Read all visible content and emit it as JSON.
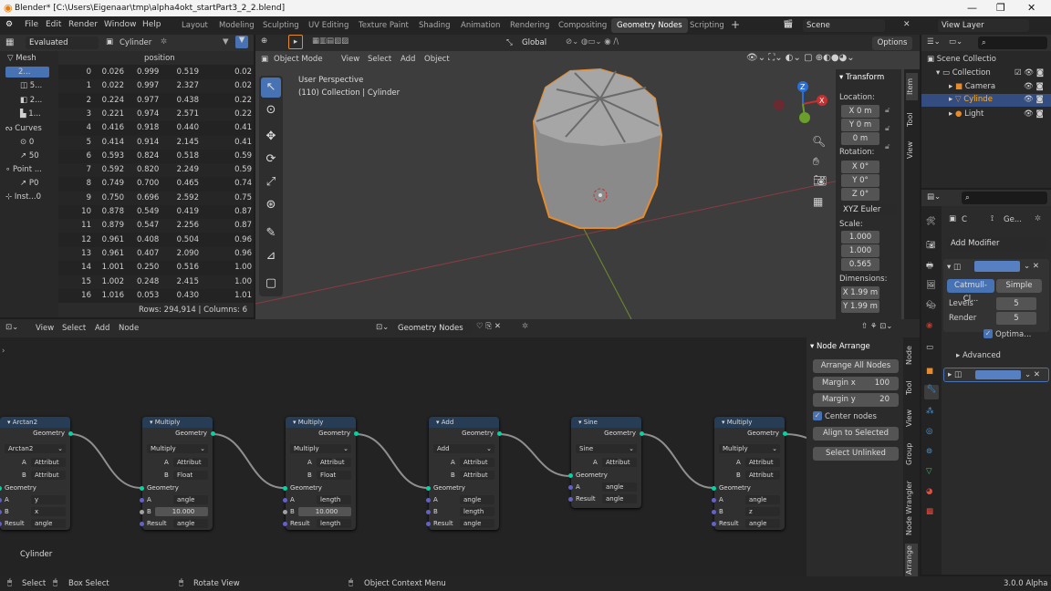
{
  "window": {
    "title": "Blender* [C:\\Users\\Eigenaar\\tmp\\alpha4okt_startPart3_2_2.blend]",
    "min": "—",
    "max": "❐",
    "close": "✕"
  },
  "menu": [
    "File",
    "Edit",
    "Render",
    "Window",
    "Help"
  ],
  "workspaces": [
    "Layout",
    "Modeling",
    "Sculpting",
    "UV Editing",
    "Texture Paint",
    "Shading",
    "Animation",
    "Rendering",
    "Compositing",
    "Geometry Nodes",
    "Scripting"
  ],
  "active_workspace": "Geometry Nodes",
  "scene": "Scene",
  "view_layer": "View Layer",
  "spreadsheet": {
    "mode": "Evaluated",
    "object": "Cylinder",
    "col_header": "position",
    "sidebar": [
      {
        "label": "Mesh"
      },
      {
        "label": "2..."
      },
      {
        "label": "5..."
      },
      {
        "label": "2..."
      },
      {
        "label": "1..."
      },
      {
        "label": "Curves"
      },
      {
        "label": "0"
      },
      {
        "label": "50"
      },
      {
        "label": "Point ..."
      },
      {
        "label": "P0"
      },
      {
        "label": "Inst...0"
      }
    ],
    "rows": [
      [
        "0",
        "0.026",
        "0.999",
        "0.519",
        "0.02"
      ],
      [
        "1",
        "0.022",
        "0.997",
        "2.327",
        "0.02"
      ],
      [
        "2",
        "0.224",
        "0.977",
        "0.438",
        "0.22"
      ],
      [
        "3",
        "0.221",
        "0.974",
        "2.571",
        "0.22"
      ],
      [
        "4",
        "0.416",
        "0.918",
        "0.440",
        "0.41"
      ],
      [
        "5",
        "0.414",
        "0.914",
        "2.145",
        "0.41"
      ],
      [
        "6",
        "0.593",
        "0.824",
        "0.518",
        "0.59"
      ],
      [
        "7",
        "0.592",
        "0.820",
        "2.249",
        "0.59"
      ],
      [
        "8",
        "0.749",
        "0.700",
        "0.465",
        "0.74"
      ],
      [
        "9",
        "0.750",
        "0.696",
        "2.592",
        "0.75"
      ],
      [
        "10",
        "0.878",
        "0.549",
        "0.419",
        "0.87"
      ],
      [
        "11",
        "0.879",
        "0.547",
        "2.256",
        "0.87"
      ],
      [
        "12",
        "0.961",
        "0.408",
        "0.504",
        "0.96"
      ],
      [
        "13",
        "0.961",
        "0.407",
        "2.090",
        "0.96"
      ],
      [
        "14",
        "1.001",
        "0.250",
        "0.516",
        "1.00"
      ],
      [
        "15",
        "1.002",
        "0.248",
        "2.415",
        "1.00"
      ],
      [
        "16",
        "1.016",
        "0.053",
        "0.430",
        "1.01"
      ]
    ],
    "footer": "Rows: 294,914   |   Columns: 6"
  },
  "viewport": {
    "mode": "Object Mode",
    "menus": [
      "View",
      "Select",
      "Add",
      "Object"
    ],
    "transform": "Global",
    "options": "Options",
    "persp": "User Perspective",
    "collection": "(110) Collection | Cylinder"
  },
  "npanel": {
    "title": "Transform",
    "location": "Location:",
    "loc": [
      "X 0 m",
      "Y 0 m",
      "0 m"
    ],
    "rotation": "Rotation:",
    "rot": [
      "X 0°",
      "Y 0°",
      "Z 0°"
    ],
    "euler": "XYZ Euler",
    "scale": "Scale:",
    "scl": [
      "1.000",
      "1.000",
      "0.565"
    ],
    "dimensions": "Dimensions:",
    "dim": [
      "X 1.99 m",
      "Y 1.99 m"
    ],
    "tabs": [
      "Item",
      "Tool",
      "View"
    ]
  },
  "outliner": {
    "items": [
      "Scene Collectio",
      "Collection",
      "Camera",
      "Cylinde",
      "Light"
    ]
  },
  "properties": {
    "obj": "C",
    "mod": "Ge...",
    "add_modifier": "Add Modifier",
    "catmull": "Catmull-Cl...",
    "simple": "Simple",
    "levels_label": "Levels",
    "levels": "5",
    "render_label": "Render",
    "render": "5",
    "optimal": "Optima...",
    "advanced": "Advanced"
  },
  "node_editor": {
    "menus": [
      "View",
      "Select",
      "Add",
      "Node"
    ],
    "tree": "Geometry Nodes",
    "cylinder": "Cylinder",
    "arrange": {
      "title": "Node Arrange",
      "all": "Arrange All Nodes",
      "mx_label": "Margin x",
      "mx": "100",
      "my_label": "Margin y",
      "my": "20",
      "center": "Center nodes",
      "sel": "Align to Selected",
      "unlink": "Select Unlinked"
    },
    "tabs": [
      "Node",
      "Tool",
      "View",
      "Group",
      "Node Wrangler",
      "Arrange"
    ],
    "nodes": [
      {
        "title": "Arctan2",
        "op": "Arctan2",
        "a": "A",
        "a_val": "Attribut",
        "b": "B",
        "b_val": "Attribut",
        "geo_out": "Geometry",
        "geo_in": "Geometry",
        "in1": "A",
        "v1": "y",
        "in2": "B",
        "v2": "x",
        "res": "Result",
        "rv": "angle"
      },
      {
        "title": "Multiply",
        "op": "Multiply",
        "a": "A",
        "a_val": "Attribut",
        "b": "B",
        "b_val": "Float",
        "geo_out": "Geometry",
        "geo_in": "Geometry",
        "in1": "A",
        "v1": "angle",
        "in2": "B",
        "v2": "10.000",
        "res": "Result",
        "rv": "angle"
      },
      {
        "title": "Multiply",
        "op": "Multiply",
        "a": "A",
        "a_val": "Attribut",
        "b": "B",
        "b_val": "Float",
        "geo_out": "Geometry",
        "geo_in": "Geometry",
        "in1": "A",
        "v1": "length",
        "in2": "B",
        "v2": "10.000",
        "res": "Result",
        "rv": "length"
      },
      {
        "title": "Add",
        "op": "Add",
        "a": "A",
        "a_val": "Attribut",
        "b": "B",
        "b_val": "Attribut",
        "geo_out": "Geometry",
        "geo_in": "Geometry",
        "in1": "A",
        "v1": "angle",
        "in2": "B",
        "v2": "length",
        "res": "Result",
        "rv": "angle"
      },
      {
        "title": "Sine",
        "op": "Sine",
        "a": "A",
        "a_val": "Attribut",
        "b": "",
        "b_val": "",
        "geo_out": "Geometry",
        "geo_in": "Geometry",
        "in1": "A",
        "v1": "angle",
        "in2": "",
        "v2": "",
        "res": "Result",
        "rv": "angle"
      },
      {
        "title": "Multiply",
        "op": "Multiply",
        "a": "A",
        "a_val": "Attribut",
        "b": "B",
        "b_val": "Attribut",
        "geo_out": "Geometry",
        "geo_in": "Geometry",
        "in1": "A",
        "v1": "angle",
        "in2": "B",
        "v2": "z",
        "res": "Result",
        "rv": "angle"
      }
    ]
  },
  "status": {
    "select": "Select",
    "box": "Box Select",
    "rotate": "Rotate View",
    "ctx": "Object Context Menu",
    "version": "3.0.0 Alpha"
  },
  "colors": {
    "accent": "#4772b3",
    "node_header": "#273c55",
    "geo_socket": "#00d6a3",
    "float_socket": "#a1a1a1",
    "attr_socket": "#6363c7",
    "orange": "#e78a2b"
  }
}
